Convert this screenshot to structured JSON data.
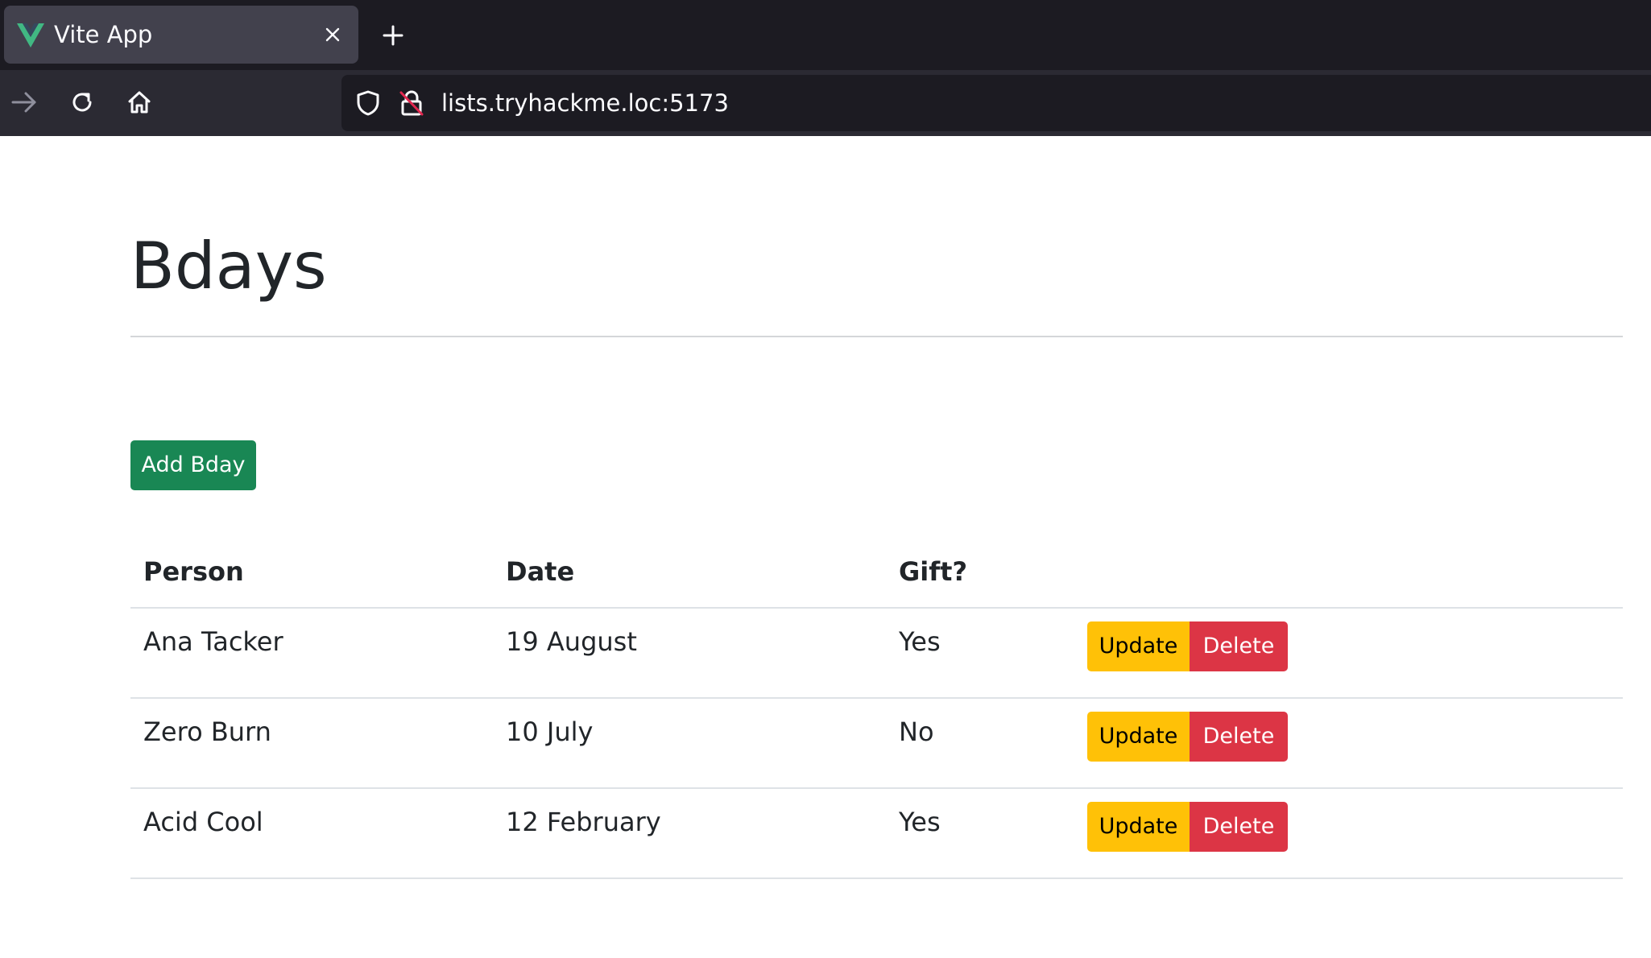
{
  "browser": {
    "tab": {
      "title": "Vite App",
      "favicon": "vue-logo-icon"
    },
    "url": "lists.tryhackme.loc:5173",
    "nav_icons": [
      "forward-arrow-icon",
      "reload-icon",
      "home-icon"
    ],
    "url_icons": [
      "tracking-protection-shield-icon",
      "insecure-lock-icon"
    ]
  },
  "page": {
    "title": "Bdays",
    "add_button_label": "Add Bday"
  },
  "table": {
    "headers": [
      "Person",
      "Date",
      "Gift?"
    ],
    "rows": [
      {
        "person": "Ana Tacker",
        "date": "19 August",
        "gift": "Yes"
      },
      {
        "person": "Zero Burn",
        "date": "10 July",
        "gift": "No"
      },
      {
        "person": "Acid Cool",
        "date": "12 February",
        "gift": "Yes"
      }
    ],
    "update_label": "Update",
    "delete_label": "Delete"
  },
  "colors": {
    "add_button": "#198754",
    "update_button": "#ffc107",
    "delete_button": "#dc3545",
    "vue_green": "#41b883"
  }
}
